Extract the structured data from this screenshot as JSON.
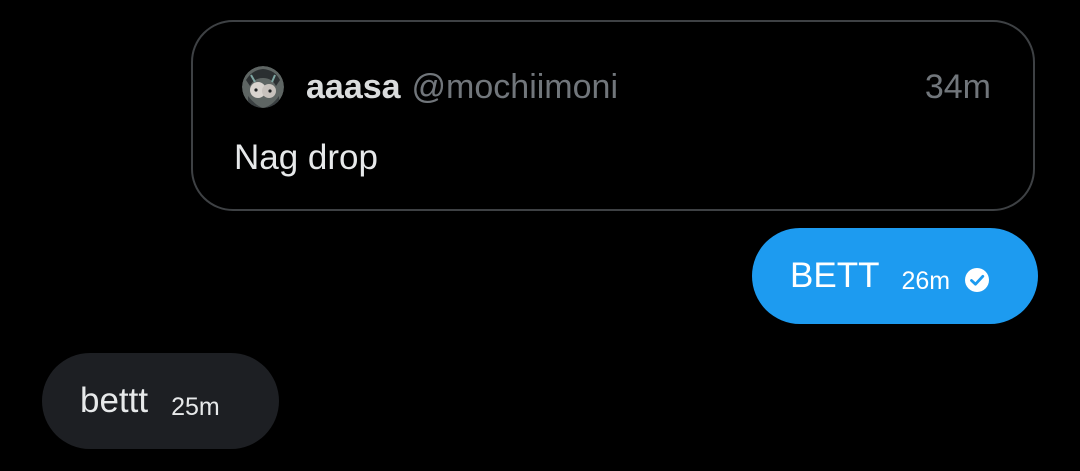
{
  "colors": {
    "background": "#000000",
    "sent_bubble": "#1d9bf0",
    "received_bubble": "#1d1f23",
    "muted_text": "#71767b",
    "quote_border": "#3e4144"
  },
  "quoted_post": {
    "avatar_icon": "profile-avatar",
    "author_name": "aaasa",
    "author_handle": "@mochiimoni",
    "time": "34m",
    "text": "Nag drop"
  },
  "messages": [
    {
      "direction": "sent",
      "text": "BETT",
      "time": "26m",
      "status_icon": "read-check-icon"
    },
    {
      "direction": "received",
      "text": "bettt",
      "time": "25m"
    }
  ]
}
